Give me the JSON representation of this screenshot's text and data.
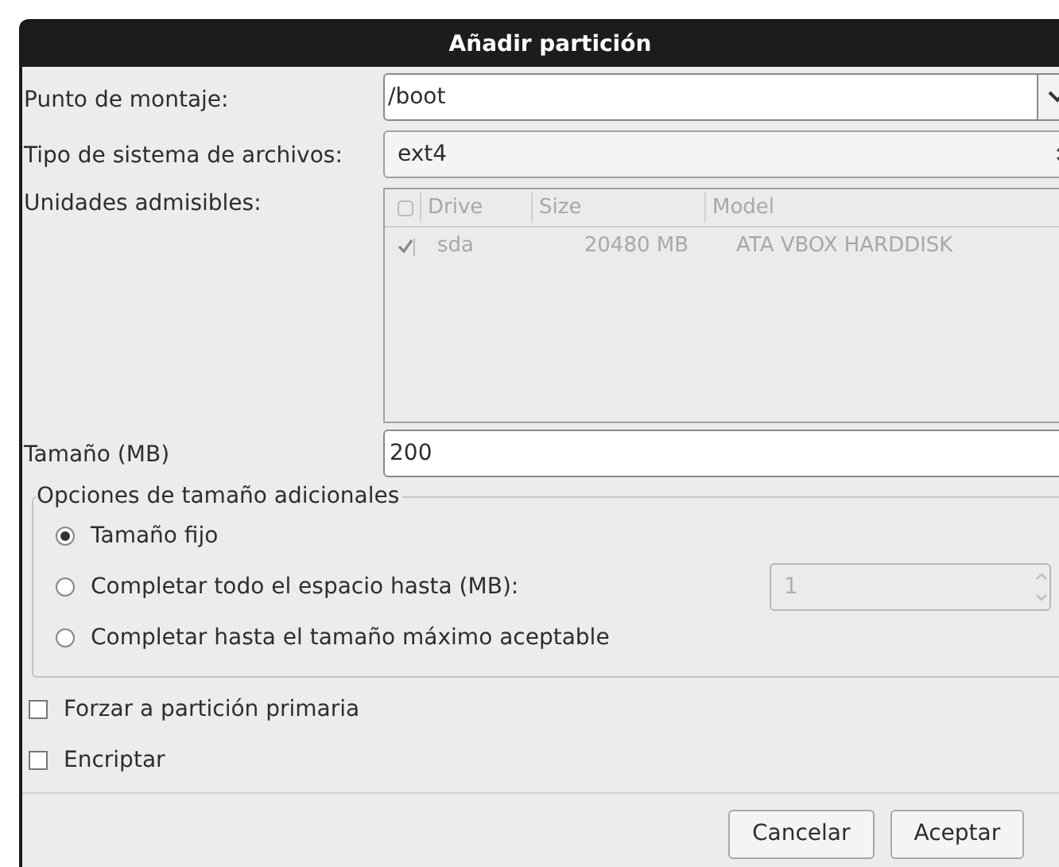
{
  "window": {
    "title": "Añadir partición"
  },
  "mount_point": {
    "label": "Punto de montaje:",
    "value": "/boot"
  },
  "fs_type": {
    "label": "Tipo de sistema de archivos:",
    "value": "ext4"
  },
  "drives": {
    "label": "Unidades admisibles:",
    "disabled": true,
    "columns": [
      "Drive",
      "Size",
      "Model"
    ],
    "rows": [
      {
        "checked": true,
        "cells": [
          "sda",
          "20480 MB",
          "ATA VBOX HARDDISK"
        ]
      }
    ]
  },
  "size": {
    "label": "Tamaño (MB)",
    "value": "200"
  },
  "size_options": {
    "title": "Opciones de tamaño adicionales",
    "options": [
      {
        "label": "Tamaño fijo",
        "selected": true
      },
      {
        "label": "Completar todo el espacio hasta (MB):",
        "selected": false,
        "spin": {
          "value": "1",
          "disabled": true
        }
      },
      {
        "label": "Completar hasta el tamaño máximo aceptable",
        "selected": false
      }
    ]
  },
  "checkboxes": [
    {
      "label": "Forzar a partición primaria",
      "checked": false
    },
    {
      "label": "Encriptar",
      "checked": false
    }
  ],
  "buttons": [
    "Cancelar",
    "Aceptar"
  ]
}
